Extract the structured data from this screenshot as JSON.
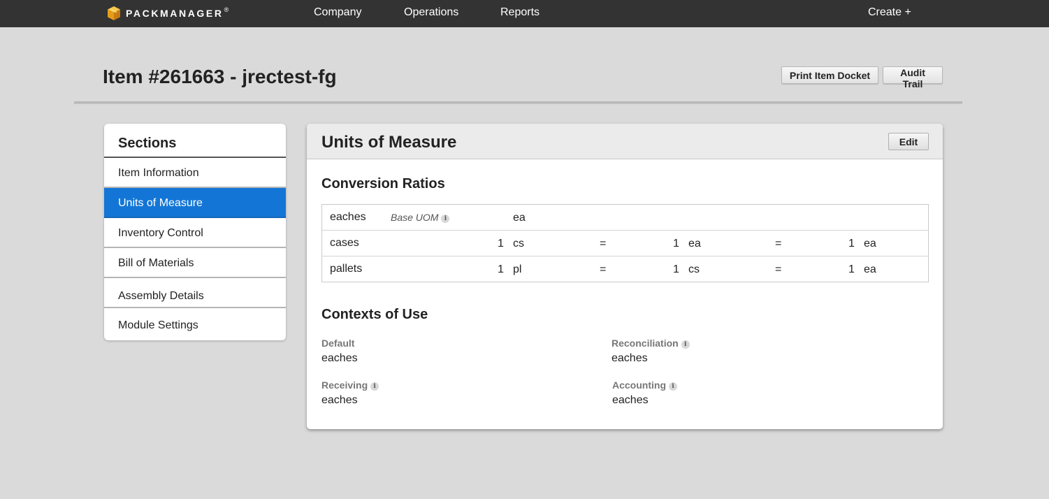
{
  "nav": {
    "logo_text": "PACKMANAGER",
    "logo_reg": "®",
    "company": "Company",
    "operations": "Operations",
    "reports": "Reports",
    "create": "Create +"
  },
  "header": {
    "title": "Item #261663 - jrectest-fg",
    "print_docket": "Print Item Docket",
    "audit_trail": "Audit Trail"
  },
  "sections": {
    "title": "Sections",
    "items": [
      {
        "label": "Item Information"
      },
      {
        "label": "Units of Measure"
      },
      {
        "label": "Inventory Control"
      },
      {
        "label": "Bill of Materials"
      },
      {
        "label": "Assembly Details"
      },
      {
        "label": "Module Settings"
      }
    ]
  },
  "main": {
    "title": "Units of Measure",
    "edit": "Edit",
    "conversion_title": "Conversion Ratios",
    "base_uom_label": "Base UOM",
    "rows": [
      {
        "name": "eaches",
        "abbr": "ea"
      },
      {
        "name": "cases",
        "q1": "1",
        "u1": "cs",
        "eq1": "=",
        "q2": "1",
        "u2": "ea",
        "eq2": "=",
        "q3": "1",
        "u3": "ea"
      },
      {
        "name": "pallets",
        "q1": "1",
        "u1": "pl",
        "eq1": "=",
        "q2": "1",
        "u2": "cs",
        "eq2": "=",
        "q3": "1",
        "u3": "ea"
      }
    ],
    "contexts_title": "Contexts of Use",
    "contexts": {
      "default_label": "Default",
      "default_value": "eaches",
      "reconciliation_label": "Reconciliation",
      "reconciliation_value": "eaches",
      "receiving_label": "Receiving",
      "receiving_value": "eaches",
      "accounting_label": "Accounting",
      "accounting_value": "eaches"
    }
  },
  "colors": {
    "topbar": "#333333",
    "accent": "#1376d6",
    "background": "#dadada"
  }
}
